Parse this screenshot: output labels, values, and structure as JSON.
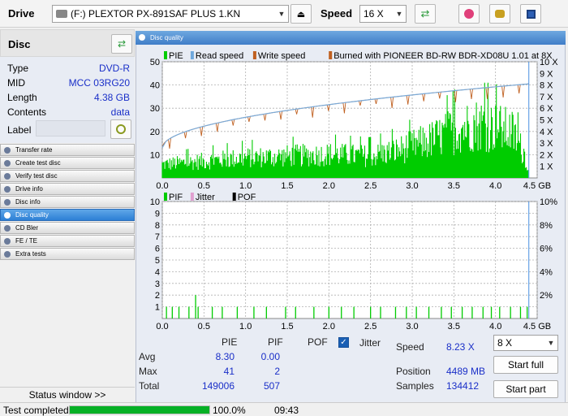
{
  "toolbar": {
    "drive_label": "Drive",
    "drive_value": "(F:)   PLEXTOR PX-891SAF PLUS 1.KN",
    "speed_label": "Speed",
    "speed_value": "16 X"
  },
  "disc": {
    "header": "Disc",
    "rows": [
      {
        "key": "Type",
        "value": "DVD-R"
      },
      {
        "key": "MID",
        "value": "MCC 03RG20"
      },
      {
        "key": "Length",
        "value": "4.38 GB"
      },
      {
        "key": "Contents",
        "value": "data"
      }
    ],
    "label_key": "Label",
    "label_value": ""
  },
  "nav": [
    {
      "label": "Transfer rate",
      "active": false
    },
    {
      "label": "Create test disc",
      "active": false
    },
    {
      "label": "Verify test disc",
      "active": false
    },
    {
      "label": "Drive info",
      "active": false
    },
    {
      "label": "Disc info",
      "active": false
    },
    {
      "label": "Disc quality",
      "active": true
    },
    {
      "label": "CD Bler",
      "active": false
    },
    {
      "label": "FE / TE",
      "active": false
    },
    {
      "label": "Extra tests",
      "active": false
    }
  ],
  "status_window_button": "Status window >>",
  "panel_title": "Disc quality",
  "chart_data": [
    {
      "type": "bar",
      "legend": [
        {
          "name": "PIE",
          "color": "#00cc00"
        },
        {
          "name": "Read speed",
          "color": "#6fa8dc"
        },
        {
          "name": "Write speed",
          "color": "#c06020"
        },
        {
          "name": "Burned with PIONEER BD-RW   BDR-XD08U 1.01 at 8X",
          "color": "#c06020"
        }
      ],
      "x_ticks": [
        "0.0",
        "0.5",
        "1.0",
        "1.5",
        "2.0",
        "2.5",
        "3.0",
        "3.5",
        "4.0",
        "4.5 GB"
      ],
      "xlim": [
        0,
        4.5
      ],
      "y_ticks": [
        "10",
        "20",
        "30",
        "40",
        "50"
      ],
      "ylim": [
        0,
        50
      ],
      "y2_ticks": [
        "1 X",
        "2 X",
        "3 X",
        "4 X",
        "5 X",
        "6 X",
        "7 X",
        "8 X",
        "9 X",
        "10 X"
      ],
      "y2lim": [
        0,
        10
      ],
      "pie_envelope": {
        "x": [
          0.0,
          0.5,
          1.0,
          1.5,
          2.0,
          2.5,
          2.8,
          3.0,
          3.2,
          3.4,
          3.6,
          3.8,
          4.0,
          4.2,
          4.35,
          4.4
        ],
        "y": [
          8,
          10,
          12,
          13,
          14,
          13,
          16,
          19,
          22,
          26,
          30,
          32,
          30,
          27,
          14,
          3
        ]
      },
      "read_speed": {
        "x": [
          0.0,
          4.4
        ],
        "y": [
          2.6,
          8.1
        ]
      }
    },
    {
      "type": "bar",
      "legend": [
        {
          "name": "PIF",
          "color": "#00cc00"
        },
        {
          "name": "Jitter",
          "color": "#e0a0d0"
        },
        {
          "name": "POF",
          "color": "#000000"
        }
      ],
      "x_ticks": [
        "0.0",
        "0.5",
        "1.0",
        "1.5",
        "2.0",
        "2.5",
        "3.0",
        "3.5",
        "4.0",
        "4.5 GB"
      ],
      "xlim": [
        0,
        4.5
      ],
      "y_ticks": [
        "1",
        "2",
        "3",
        "4",
        "5",
        "6",
        "7",
        "8",
        "9",
        "10"
      ],
      "ylim": [
        0,
        10
      ],
      "y2_ticks": [
        "2%",
        "4%",
        "6%",
        "8%",
        "10%"
      ],
      "pif_spikes": [
        0.05,
        0.12,
        0.2,
        0.32,
        0.4,
        0.43,
        0.6,
        0.72,
        0.9,
        1.1,
        1.25,
        1.48,
        1.6,
        1.82,
        2.0,
        2.15,
        2.3,
        2.5,
        2.62,
        2.8,
        2.93,
        3.05,
        3.2,
        3.35,
        3.47,
        3.6,
        3.72,
        3.85,
        3.95,
        4.05,
        4.18,
        4.3,
        4.38
      ],
      "pif_heights": [
        1,
        1,
        1,
        1,
        2,
        1,
        1,
        1,
        1,
        1,
        1,
        1,
        1,
        1,
        1,
        1,
        1,
        1,
        1,
        1,
        1,
        1,
        1,
        1,
        1,
        1,
        1,
        1,
        1,
        1,
        1,
        1,
        1
      ]
    }
  ],
  "stats": {
    "col_pie": "PIE",
    "col_pif": "PIF",
    "col_pof": "POF",
    "jitter_label": "Jitter",
    "jitter_checked": true,
    "rows": [
      {
        "label": "Avg",
        "pie": "8.30",
        "pif": "0.00"
      },
      {
        "label": "Max",
        "pie": "41",
        "pif": "2"
      },
      {
        "label": "Total",
        "pie": "149006",
        "pif": "507"
      }
    ],
    "speed_label": "Speed",
    "speed_value": "8.23 X",
    "position_label": "Position",
    "position_value": "4489 MB",
    "samples_label": "Samples",
    "samples_value": "134412",
    "speed_select": "8 X",
    "start_full": "Start full",
    "start_part": "Start part"
  },
  "status": {
    "text": "Test completed",
    "progress": 1.0,
    "percent": "100.0%",
    "time": "09:43"
  }
}
